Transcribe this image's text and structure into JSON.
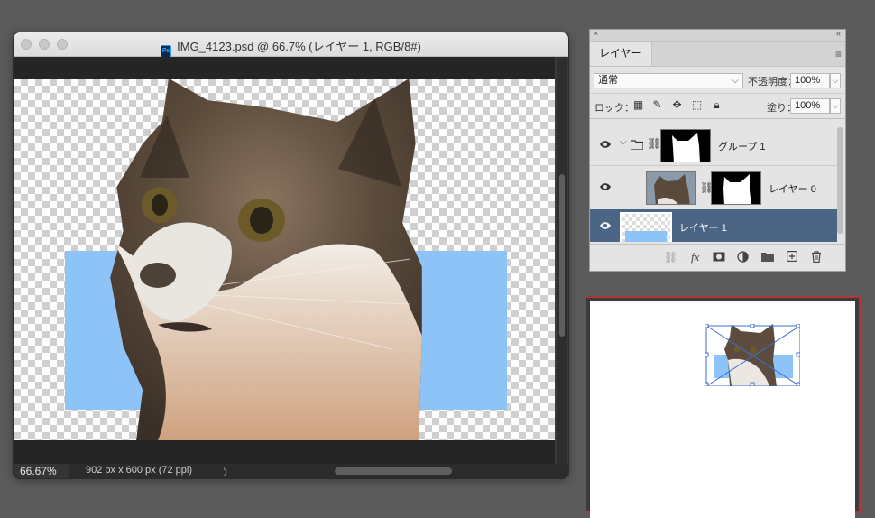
{
  "document": {
    "title": "IMG_4123.psd @ 66.7% (レイヤー 1, RGB/8#)",
    "app_badge": "Ps",
    "zoom": "66.67%",
    "doc_info": "902 px x 600 px (72 ppi)",
    "status_arrow": "〉"
  },
  "layers_panel": {
    "close_glyph": "×",
    "collapse_glyph": "«",
    "tab_label": "レイヤー",
    "menu_glyph": "≡",
    "blend_mode": "通常",
    "opacity_label": "不透明度：",
    "opacity_value": "100%",
    "lock_label": "ロック：",
    "fill_label": "塗り：",
    "fill_value": "100%",
    "layers": [
      {
        "name": "グループ 1",
        "type": "group",
        "visible": true,
        "selected": false
      },
      {
        "name": "レイヤー 0",
        "type": "layer-with-mask",
        "visible": true,
        "selected": false
      },
      {
        "name": "レイヤー 1",
        "type": "layer",
        "visible": true,
        "selected": true
      }
    ],
    "footer_icons": [
      "link-icon",
      "fx-icon",
      "mask-icon",
      "adjustment-icon",
      "folder-icon",
      "new-layer-icon",
      "trash-icon"
    ]
  },
  "colors": {
    "blue_shape": "#8dc3f6",
    "selected_layer": "#4b6585",
    "navigator_border": "#b03535"
  }
}
